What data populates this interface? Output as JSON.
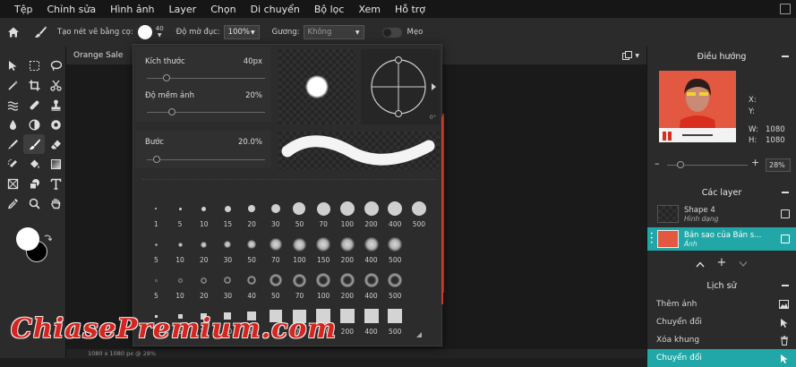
{
  "menu": [
    "Tệp",
    "Chỉnh sửa",
    "Hình ảnh",
    "Layer",
    "Chọn",
    "Di chuyển",
    "Bộ lọc",
    "Xem",
    "Hỗ trợ"
  ],
  "options": {
    "brush_label": "Tạo nét vẽ bằng cọ:",
    "brush_size": "40",
    "opacity_label": "Độ mờ đục:",
    "opacity_value": "100%",
    "mirror_label": "Gương:",
    "mirror_value": "Không",
    "tips_label": "Mẹo"
  },
  "document": {
    "tab": "Orange Sale",
    "status": "1080 x 1080 px @ 28%"
  },
  "brush_popup": {
    "size_label": "Kích thước",
    "size_value": "40px",
    "size_level": 0.1,
    "softness_label": "Độ mềm ảnh",
    "softness_value": "20%",
    "softness_level": 0.2,
    "step_label": "Bước",
    "step_value": "20.0%",
    "step_level": 0.05,
    "angle_value": "0°",
    "preset_sizes": [
      "1",
      "5",
      "10",
      "15",
      "20",
      "30",
      "50",
      "70",
      "100",
      "200",
      "400",
      "500"
    ],
    "preset_rows": [
      {
        "style": "hard",
        "labels": [
          "1",
          "5",
          "10",
          "15",
          "20",
          "30",
          "50",
          "70",
          "100",
          "200",
          "400",
          "500"
        ]
      },
      {
        "style": "soft",
        "labels": [
          "5",
          "10",
          "20",
          "30",
          "50",
          "70",
          "100",
          "150",
          "200",
          "400",
          "500"
        ]
      },
      {
        "style": "ring",
        "labels": [
          "5",
          "10",
          "20",
          "30",
          "40",
          "50",
          "70",
          "100",
          "200",
          "400",
          "500"
        ]
      },
      {
        "style": "square",
        "labels": [
          "5",
          "6",
          "10",
          "20",
          "30",
          "50",
          "70",
          "100",
          "200",
          "400",
          "500"
        ]
      }
    ]
  },
  "navigator": {
    "title": "Điều hướng",
    "x_label": "X:",
    "y_label": "Y:",
    "w_label": "W:",
    "w_value": "1080",
    "h_label": "H:",
    "h_value": "1080",
    "zoom": "28%",
    "zoom_level": 0.2
  },
  "layers": {
    "title": "Các layer",
    "items": [
      {
        "name": "Shape 4",
        "type": "Hình dạng"
      },
      {
        "name": "Bản sao của Bản s...",
        "type": "Ảnh"
      }
    ]
  },
  "history": {
    "title": "Lịch sử",
    "items": [
      "Thêm ảnh",
      "Chuyển đổi",
      "Xóa khung",
      "Chuyển đổi"
    ]
  },
  "watermark": "ChiasePremium.com",
  "colors": {
    "accent": "#21a7a7",
    "foreground": "#ffffff",
    "background": "#000000",
    "watermark": "#d4251f"
  }
}
